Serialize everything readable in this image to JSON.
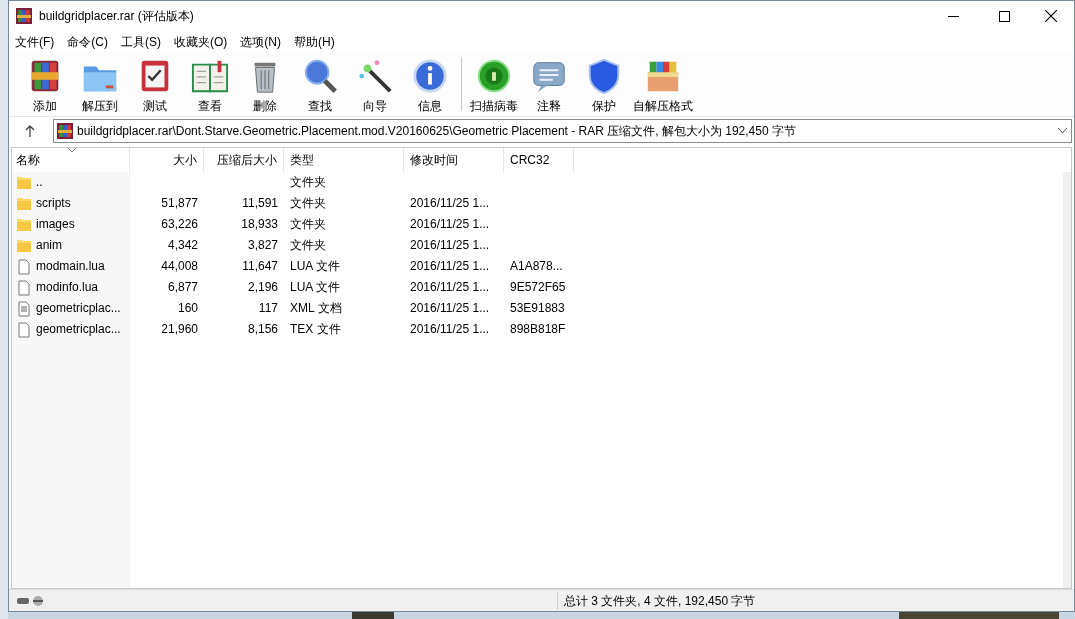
{
  "window": {
    "title": "buildgridplacer.rar (评估版本)"
  },
  "menu": [
    "文件(F)",
    "命令(C)",
    "工具(S)",
    "收藏夹(O)",
    "选项(N)",
    "帮助(H)"
  ],
  "toolbar": [
    {
      "label": "添加",
      "kind": "add"
    },
    {
      "label": "解压到",
      "kind": "extract"
    },
    {
      "label": "测试",
      "kind": "test"
    },
    {
      "label": "查看",
      "kind": "view"
    },
    {
      "label": "删除",
      "kind": "delete"
    },
    {
      "label": "查找",
      "kind": "find"
    },
    {
      "label": "向导",
      "kind": "wizard"
    },
    {
      "label": "信息",
      "kind": "info"
    },
    {
      "label": "扫描病毒",
      "kind": "scan"
    },
    {
      "label": "注释",
      "kind": "comment"
    },
    {
      "label": "保护",
      "kind": "protect"
    },
    {
      "label": "自解压格式",
      "kind": "sfx"
    }
  ],
  "address": "buildgridplacer.rar\\Dont.Starve.Geometric.Placement.mod.V20160625\\Geometric Placement - RAR 压缩文件, 解包大小为 192,450 字节",
  "table": {
    "columns": [
      "名称",
      "大小",
      "压缩后大小",
      "类型",
      "修改时间",
      "CRC32"
    ],
    "rows": [
      {
        "kind": "folder",
        "cells": [
          "..",
          "",
          "",
          "文件夹",
          "",
          ""
        ]
      },
      {
        "kind": "folder",
        "cells": [
          "scripts",
          "51,877",
          "11,591",
          "文件夹",
          "2016/11/25 1...",
          ""
        ]
      },
      {
        "kind": "folder",
        "cells": [
          "images",
          "63,226",
          "18,933",
          "文件夹",
          "2016/11/25 1...",
          ""
        ]
      },
      {
        "kind": "folder",
        "cells": [
          "anim",
          "4,342",
          "3,827",
          "文件夹",
          "2016/11/25 1...",
          ""
        ]
      },
      {
        "kind": "file",
        "cells": [
          "modmain.lua",
          "44,008",
          "11,647",
          "LUA 文件",
          "2016/11/25 1...",
          "A1A878..."
        ]
      },
      {
        "kind": "file",
        "cells": [
          "modinfo.lua",
          "6,877",
          "2,196",
          "LUA 文件",
          "2016/11/25 1...",
          "9E572F65"
        ]
      },
      {
        "kind": "xml",
        "cells": [
          "geometricplac...",
          "160",
          "117",
          "XML 文档",
          "2016/11/25 1...",
          "53E91883"
        ]
      },
      {
        "kind": "file",
        "cells": [
          "geometricplac...",
          "21,960",
          "8,156",
          "TEX 文件",
          "2016/11/25 1...",
          "898B818F"
        ]
      }
    ]
  },
  "status_bar": "总计 3 文件夹, 4 文件, 192,450 字节"
}
